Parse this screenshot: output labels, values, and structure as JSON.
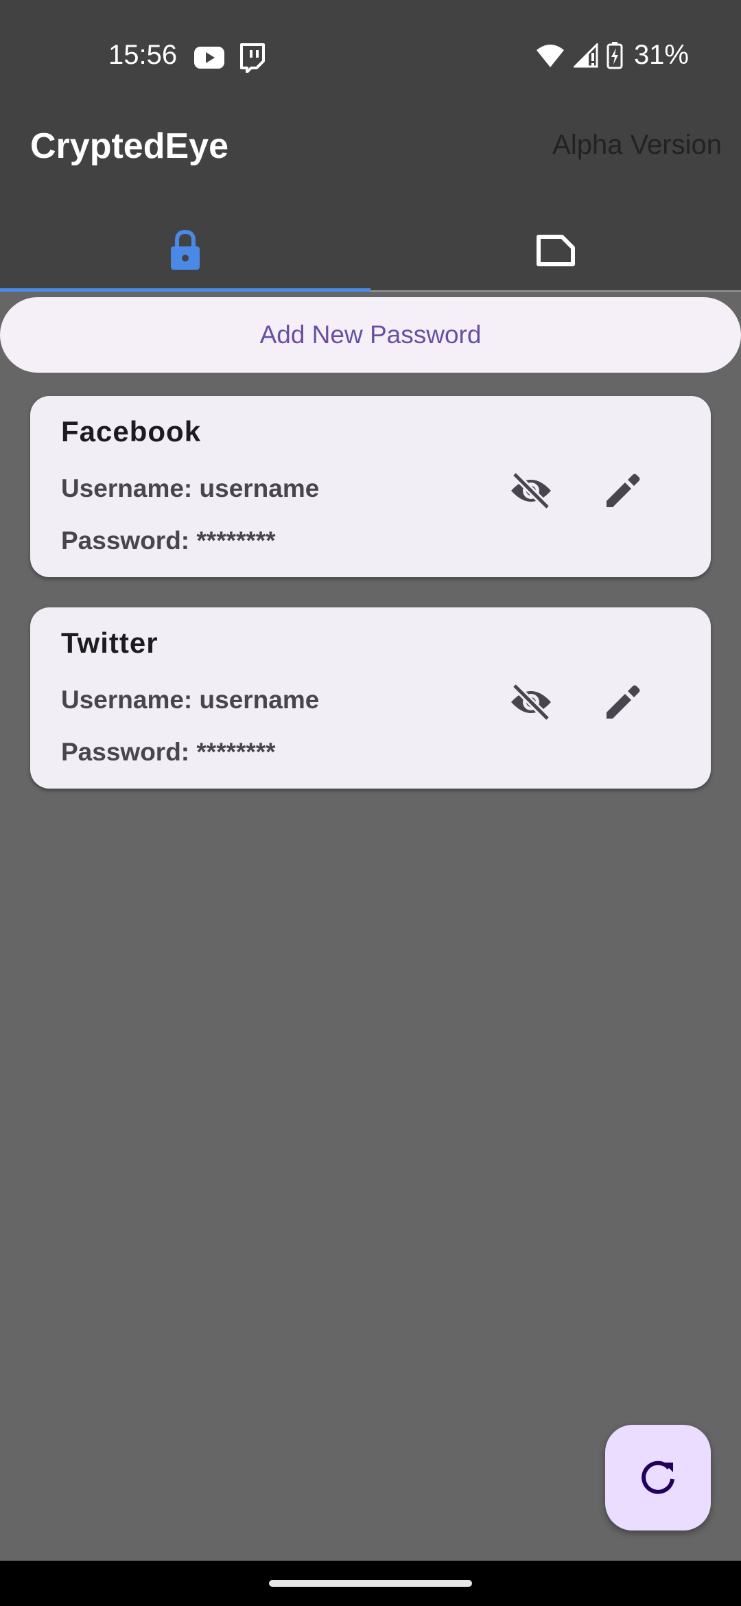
{
  "status_bar": {
    "time": "15:56",
    "notifications": [
      "youtube-icon",
      "twitch-icon"
    ],
    "icons": [
      "wifi-icon",
      "signal-icon",
      "battery-charging-icon"
    ],
    "battery": "31%"
  },
  "app_bar": {
    "title": "CryptedEye",
    "version_label": "Alpha Version",
    "tabs": [
      {
        "icon": "lock-icon",
        "selected": true
      },
      {
        "icon": "note-icon",
        "selected": false
      }
    ],
    "accent": "#4a8ae6"
  },
  "main": {
    "add_button_label": "Add New Password",
    "entries": [
      {
        "title": "Facebook",
        "username_line": "Username: username",
        "password_line": "Password: ********"
      },
      {
        "title": "Twitter",
        "username_line": "Username: username",
        "password_line": "Password: ********"
      }
    ]
  },
  "fab": {
    "icon": "refresh-icon"
  },
  "colors": {
    "background": "#666666",
    "app_bar": "#424242",
    "card": "#f2eef5",
    "primary": "#6750a4",
    "fab": "#eaddff"
  }
}
